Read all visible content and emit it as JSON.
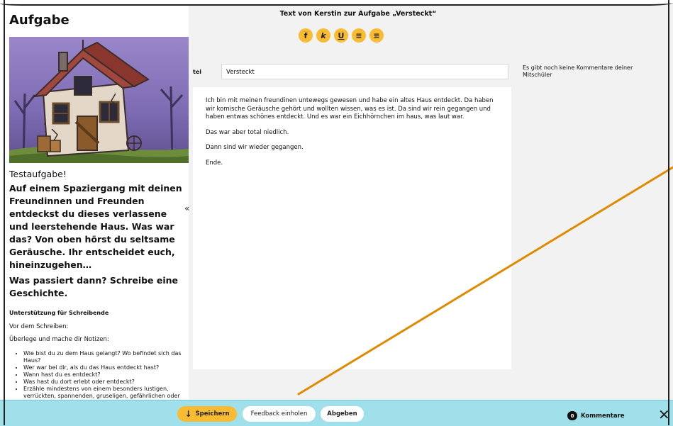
{
  "task": {
    "heading": "Aufgabe",
    "name": "Testaufgabe!",
    "prompt": "Auf einem Spaziergang mit deinen Freundinnen und Freunden entdeckst du dieses verlassene und leerstehende Haus. Was war das? Von oben hörst du seltsame Geräusche. Ihr entscheidet euch, hineinzugehen…",
    "question": "Was passiert dann? Schreibe eine Geschichte.",
    "support": {
      "heading": "Unterstützung für Schreibende",
      "before_label": "Vor dem Schreiben:",
      "instruction": "Überlege und mache dir Notizen:",
      "items": [
        "Wie bist du zu dem Haus gelangt? Wo befindet sich das Haus?",
        "Wer war bei dir, als du das Haus entdeckt hast?",
        "Wann hast du es entdeckt?",
        "Was hast du dort erlebt oder entdeckt?",
        "Erzähle mindestens von einem besonders lustigen, verrückten, spannenden, gruseligen, gefährlichen oder unangenehmen Ereignis oder einer spektakulären Entdeckung."
      ]
    },
    "collapse_label": "«"
  },
  "editor": {
    "document_title": "Text von Kerstin zur Aufgabe „Versteckt“",
    "toolbar": [
      "f",
      "k",
      "U",
      "≡",
      "≡"
    ],
    "title_label": "tel",
    "title_value": "Versteckt",
    "paragraphs": [
      "Ich bin mit meinen freundinen untewegs gewesen und habe ein altes Haus entdeckt. Da haben wir komische Geräusche gehört und wollten wissen, was es ist. Da sind wir rein gegangen und haben entwas schönes entdeckt. Und es war ein Eichhörnchen im haus, was laut war.",
      "Das war aber total niedlich.",
      "Dann sind wir wieder gegangen.",
      "Ende."
    ]
  },
  "comments": {
    "empty_text": "Es gibt noch keine Kommentare deiner Mitschüler",
    "toggle_label": "Kommentare",
    "count": "0"
  },
  "actions": {
    "save_label": "Speichern",
    "feedback_label": "Feedback einholen",
    "submit_label": "Abgeben",
    "close_label": "✕"
  },
  "colors": {
    "accent": "#f8bb32",
    "bottom_bar": "#9fe0ea",
    "editor_background": "#f2f2f2",
    "annotation_line": "#e08a00"
  },
  "icons": {
    "save": "arrow-down-icon",
    "comments": "speech-bubble-icon",
    "close": "close-icon"
  }
}
